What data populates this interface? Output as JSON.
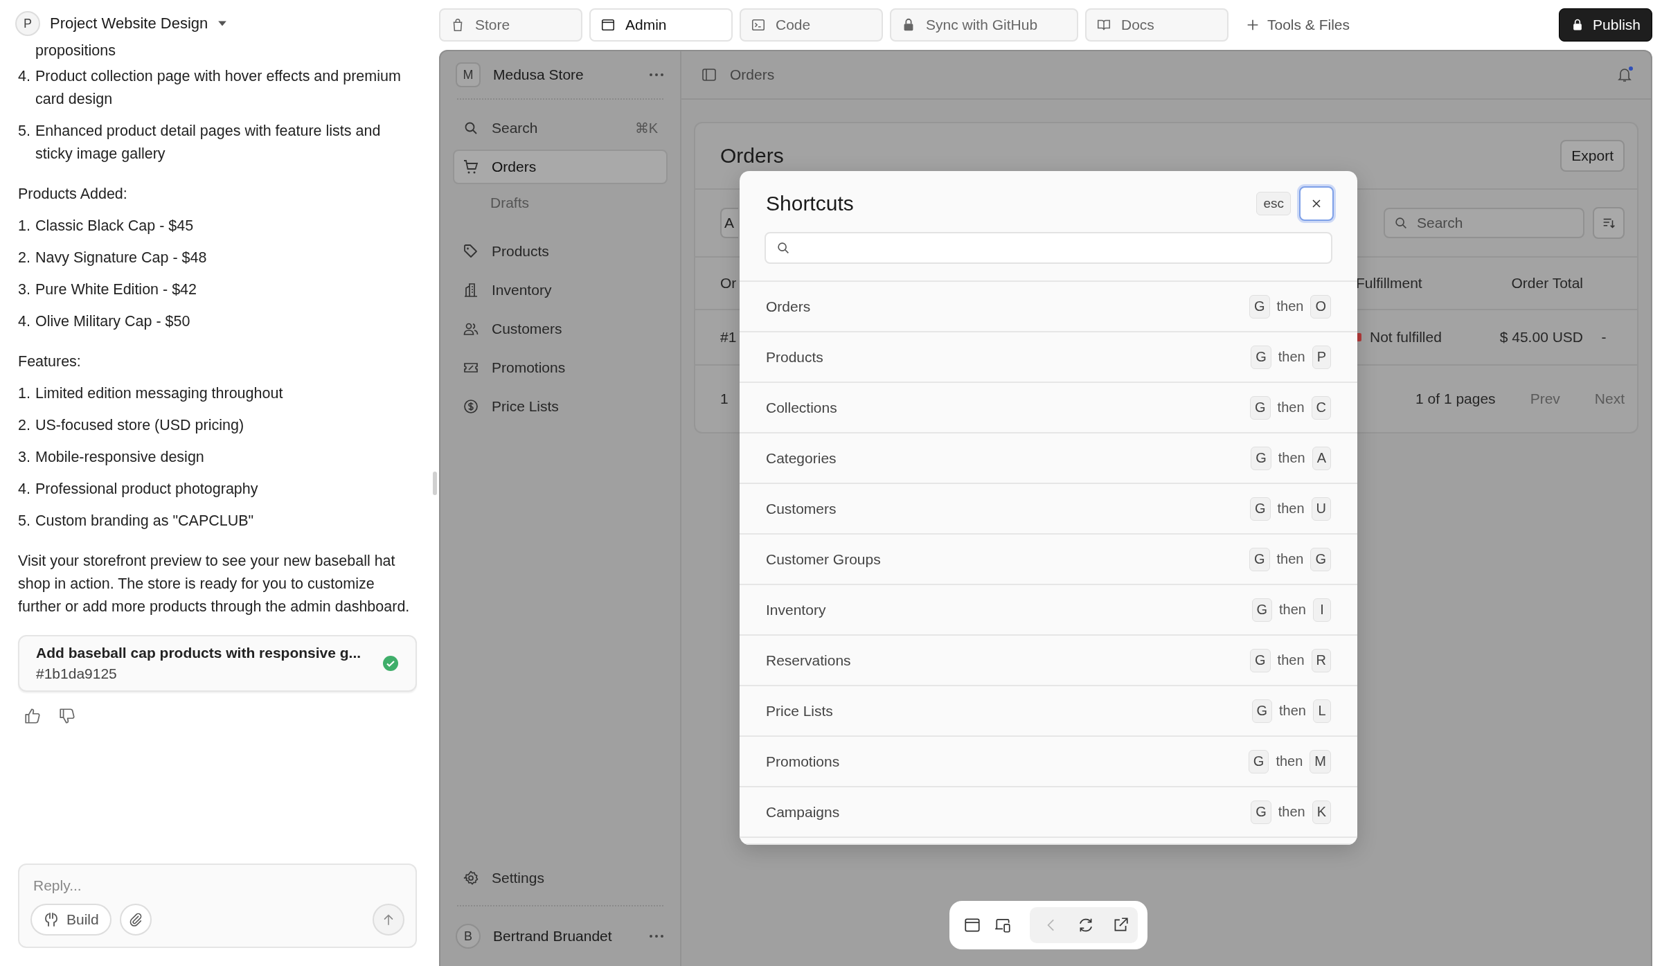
{
  "chat": {
    "avatar": "P",
    "project": "Project Website Design",
    "cut_line": "propositions",
    "intro_items": [
      {
        "n": "4.",
        "text": "Product collection page with hover effects and premium card design"
      },
      {
        "n": "5.",
        "text": "Enhanced product detail pages with feature lists and sticky image gallery"
      }
    ],
    "sections": [
      {
        "heading": "Products Added:",
        "items": [
          {
            "n": "1.",
            "text": "Classic Black Cap - $45"
          },
          {
            "n": "2.",
            "text": "Navy Signature Cap - $48"
          },
          {
            "n": "3.",
            "text": "Pure White Edition - $42"
          },
          {
            "n": "4.",
            "text": "Olive Military Cap - $50"
          }
        ]
      },
      {
        "heading": "Features:",
        "items": [
          {
            "n": "1.",
            "text": "Limited edition messaging throughout"
          },
          {
            "n": "2.",
            "text": "US-focused store (USD pricing)"
          },
          {
            "n": "3.",
            "text": "Mobile-responsive design"
          },
          {
            "n": "4.",
            "text": "Professional product photography"
          },
          {
            "n": "5.",
            "text": "Custom branding as \"CAPCLUB\""
          }
        ]
      }
    ],
    "closing": "Visit your storefront preview to see your new baseball hat shop in action. The store is ready for you to customize further or add more products through the admin dashboard.",
    "commit": {
      "title": "Add baseball cap products with responsive g...",
      "hash": "#1b1da9125",
      "done": true
    },
    "reply": {
      "placeholder": "Reply...",
      "build_label": "Build"
    }
  },
  "tabs": [
    {
      "label": "Store",
      "selected": false
    },
    {
      "label": "Admin",
      "selected": true
    },
    {
      "label": "Code",
      "selected": false
    },
    {
      "label": "Sync with GitHub",
      "selected": false
    },
    {
      "label": "Docs",
      "selected": false
    }
  ],
  "tools_label": "Tools & Files",
  "publish_label": "Publish",
  "admin_sidebar": {
    "avatar": "M",
    "store": "Medusa Store",
    "items": [
      {
        "label": "Search",
        "shortcut": "⌘K",
        "selected": false
      },
      {
        "label": "Orders",
        "selected": true,
        "children": [
          {
            "label": "Drafts",
            "selected": false
          }
        ]
      },
      {
        "label": "Products",
        "selected": false
      },
      {
        "label": "Inventory",
        "selected": false
      },
      {
        "label": "Customers",
        "selected": false
      },
      {
        "label": "Promotions",
        "selected": false
      },
      {
        "label": "Price Lists",
        "selected": false
      }
    ],
    "settings": "Settings",
    "user_avatar": "B",
    "user": "Bertrand Bruandet"
  },
  "main": {
    "breadcrumb": "Orders",
    "notifications_unread": true,
    "orders": {
      "title": "Orders",
      "export": "Export",
      "filter_button": "A",
      "search_placeholder": "Search",
      "columns": [
        "Or",
        "Fulfillment",
        "Order Total"
      ],
      "row": {
        "column_1": "#1",
        "fulfillment": "Not fulfilled",
        "color": "#b53a3a",
        "total": "$ 45.00 USD",
        "column_4": "-"
      },
      "footer": {
        "column_1": "1",
        "pages": "1 of 1 pages",
        "prev": "Prev",
        "next": "Next"
      }
    }
  },
  "shortcuts_dialog": {
    "title": "Shortcuts",
    "esc": "esc",
    "items": [
      {
        "label": "Orders",
        "first": "G",
        "joiner": "then",
        "second": "O"
      },
      {
        "label": "Products",
        "first": "G",
        "joiner": "then",
        "second": "P"
      },
      {
        "label": "Collections",
        "first": "G",
        "joiner": "then",
        "second": "C"
      },
      {
        "label": "Categories",
        "first": "G",
        "joiner": "then",
        "second": "A"
      },
      {
        "label": "Customers",
        "first": "G",
        "joiner": "then",
        "second": "U"
      },
      {
        "label": "Customer Groups",
        "first": "G",
        "joiner": "then",
        "second": "G"
      },
      {
        "label": "Inventory",
        "first": "G",
        "joiner": "then",
        "second": "I"
      },
      {
        "label": "Reservations",
        "first": "G",
        "joiner": "then",
        "second": "R"
      },
      {
        "label": "Price Lists",
        "first": "G",
        "joiner": "then",
        "second": "L"
      },
      {
        "label": "Promotions",
        "first": "G",
        "joiner": "then",
        "second": "M"
      },
      {
        "label": "Campaigns",
        "first": "G",
        "joiner": "then",
        "second": "K"
      }
    ]
  },
  "preview_toolbar": {
    "back_disabled": true
  }
}
